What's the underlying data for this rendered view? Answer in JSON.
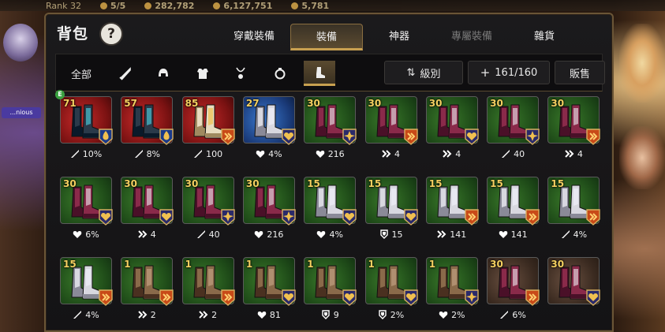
{
  "hud": {
    "a": "5/5",
    "b": "282,782",
    "c": "6,127,751",
    "d": "5,781"
  },
  "side": {
    "rank": "Rank 32",
    "badge": "...nious"
  },
  "window": {
    "title": "背包",
    "help": "?"
  },
  "tabs": [
    {
      "label": "穿戴裝備",
      "state": "normal"
    },
    {
      "label": "裝備",
      "state": "active"
    },
    {
      "label": "神器",
      "state": "normal"
    },
    {
      "label": "專屬裝備",
      "state": "dim"
    },
    {
      "label": "雜貨",
      "state": "normal"
    }
  ],
  "filters": {
    "all_label": "全部",
    "items": [
      "weapon",
      "helmet",
      "armor",
      "necklace",
      "ring",
      "boots"
    ],
    "active": "boots"
  },
  "controls": {
    "sort_label": "級別",
    "capacity": "161/160",
    "sell_label": "販售"
  },
  "colors": {
    "accent": "#c8a050",
    "level": "#f4d060",
    "rare_green": "#2a6a20",
    "epic_red": "#a01818",
    "heroic_blue": "#2a5aa8"
  },
  "items": [
    {
      "level": "71",
      "rarity": "r",
      "boot": "dark",
      "badge": "blue",
      "stat_icon": "attack",
      "stat": "10%",
      "equipped": true
    },
    {
      "level": "57",
      "rarity": "r",
      "boot": "dark",
      "badge": "blue",
      "stat_icon": "attack",
      "stat": "8%"
    },
    {
      "level": "85",
      "rarity": "r",
      "boot": "gold",
      "badge": "orange",
      "stat_icon": "attack",
      "stat": "100"
    },
    {
      "level": "27",
      "rarity": "b",
      "boot": "silver",
      "badge": "heart",
      "stat_icon": "heart",
      "stat": "4%"
    },
    {
      "level": "30",
      "rarity": "g",
      "boot": "maroon",
      "badge": "star",
      "stat_icon": "heart",
      "stat": "216"
    },
    {
      "level": "30",
      "rarity": "g",
      "boot": "maroon",
      "badge": "orange",
      "stat_icon": "speed",
      "stat": "4"
    },
    {
      "level": "30",
      "rarity": "g",
      "boot": "maroon",
      "badge": "heart",
      "stat_icon": "speed",
      "stat": "4"
    },
    {
      "level": "30",
      "rarity": "g",
      "boot": "maroon",
      "badge": "star",
      "stat_icon": "attack",
      "stat": "40"
    },
    {
      "level": "30",
      "rarity": "g",
      "boot": "maroon",
      "badge": "orange",
      "stat_icon": "speed",
      "stat": "4"
    },
    {
      "level": "30",
      "rarity": "g",
      "boot": "maroon",
      "badge": "heart",
      "stat_icon": "heart",
      "stat": "6%"
    },
    {
      "level": "30",
      "rarity": "g",
      "boot": "maroon",
      "badge": "heart",
      "stat_icon": "speed",
      "stat": "4"
    },
    {
      "level": "30",
      "rarity": "g",
      "boot": "maroon",
      "badge": "star",
      "stat_icon": "attack",
      "stat": "40"
    },
    {
      "level": "30",
      "rarity": "g",
      "boot": "maroon",
      "badge": "star",
      "stat_icon": "heart",
      "stat": "216"
    },
    {
      "level": "15",
      "rarity": "g",
      "boot": "silver",
      "badge": "heart",
      "stat_icon": "heart",
      "stat": "4%"
    },
    {
      "level": "15",
      "rarity": "g",
      "boot": "silver",
      "badge": "heart",
      "stat_icon": "shield",
      "stat": "15"
    },
    {
      "level": "15",
      "rarity": "g",
      "boot": "silver",
      "badge": "orange",
      "stat_icon": "speed",
      "stat": "141"
    },
    {
      "level": "15",
      "rarity": "g",
      "boot": "silver",
      "badge": "orange",
      "stat_icon": "heart",
      "stat": "141"
    },
    {
      "level": "15",
      "rarity": "g",
      "boot": "silver",
      "badge": "orange",
      "stat_icon": "attack",
      "stat": "4%"
    },
    {
      "level": "15",
      "rarity": "g",
      "boot": "silver",
      "badge": "orange",
      "stat_icon": "attack",
      "stat": "4%"
    },
    {
      "level": "1",
      "rarity": "g",
      "boot": "brown",
      "badge": "orange",
      "stat_icon": "speed",
      "stat": "2"
    },
    {
      "level": "1",
      "rarity": "g",
      "boot": "brown",
      "badge": "orange",
      "stat_icon": "speed",
      "stat": "2"
    },
    {
      "level": "1",
      "rarity": "g",
      "boot": "brown",
      "badge": "heart",
      "stat_icon": "heart",
      "stat": "81"
    },
    {
      "level": "1",
      "rarity": "g",
      "boot": "brown",
      "badge": "heart",
      "stat_icon": "shield",
      "stat": "9"
    },
    {
      "level": "1",
      "rarity": "g",
      "boot": "brown",
      "badge": "heart",
      "stat_icon": "shield",
      "stat": "2%"
    },
    {
      "level": "1",
      "rarity": "g",
      "boot": "brown",
      "badge": "star",
      "stat_icon": "heart",
      "stat": "2%"
    },
    {
      "level": "30",
      "rarity": "n",
      "boot": "maroon",
      "badge": "orange",
      "stat_icon": "attack",
      "stat": "6%"
    },
    {
      "level": "30",
      "rarity": "n",
      "boot": "maroon",
      "badge": "heart",
      "stat_icon": "",
      "stat": ""
    }
  ]
}
